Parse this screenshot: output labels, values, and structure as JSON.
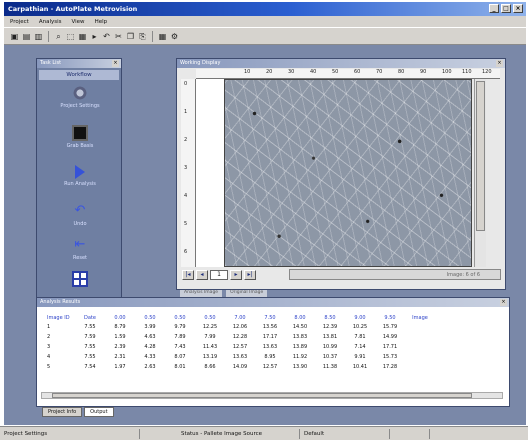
{
  "window": {
    "title": "Carpathian - AutoPlate Metrovision"
  },
  "menu": [
    "Project",
    "Analysis",
    "View",
    "Help"
  ],
  "toolbar": {
    "icons": [
      "new-icon",
      "open-icon",
      "save-icon",
      "zoom-icon",
      "select-icon",
      "print-icon",
      "arrow-icon",
      "undo-icon",
      "cut-icon",
      "copy-icon",
      "paste-icon",
      "grid-icon",
      "settings-icon"
    ]
  },
  "task_panel": {
    "title": "Task List",
    "header": "Workflow",
    "items": [
      {
        "label": "Project Settings",
        "icon": "gear-icon"
      },
      {
        "label": "Grab Basis",
        "icon": "film-icon"
      },
      {
        "label": "Run Analysis",
        "icon": "play-icon"
      },
      {
        "label": "Undo",
        "icon": "undo-icon"
      },
      {
        "label": "Reset",
        "icon": "reset-icon"
      },
      {
        "label": "",
        "icon": "grid-icon"
      }
    ]
  },
  "image_window": {
    "title": "Working Display",
    "ruler_top": [
      "10",
      "20",
      "30",
      "40",
      "50",
      "60",
      "70",
      "80",
      "90",
      "100",
      "110",
      "120"
    ],
    "ruler_left": [
      "0",
      "1",
      "2",
      "3",
      "4",
      "5",
      "6"
    ],
    "page": "1",
    "status": "Image: 6 of 6",
    "tabs": [
      "Analysis Image",
      "Original Image"
    ]
  },
  "results": {
    "title": "Analysis Results",
    "headers": [
      "Image ID",
      "Date",
      "0.00",
      "0.50",
      "0.50",
      "0.50",
      "7.00",
      "7.50",
      "8.00",
      "8.50",
      "9.00",
      "9.50",
      "Image"
    ],
    "rows": [
      [
        "1",
        "7.55",
        "8.79",
        "3.99",
        "9.79",
        "12.25",
        "12.06",
        "13.56",
        "14.50",
        "12.39",
        "10.25",
        "15.79",
        ""
      ],
      [
        "2",
        "7.59",
        "1.59",
        "4.63",
        "7.89",
        "7.99",
        "12.28",
        "17.17",
        "13.83",
        "13.81",
        "7.81",
        "14.99",
        ""
      ],
      [
        "3",
        "7.55",
        "2.39",
        "4.28",
        "7.43",
        "11.43",
        "12.57",
        "13.63",
        "13.89",
        "10.99",
        "7.14",
        "17.71",
        ""
      ],
      [
        "4",
        "7.55",
        "2.31",
        "4.33",
        "8.07",
        "13.19",
        "13.63",
        "8.95",
        "11.92",
        "10.37",
        "9.91",
        "15.73",
        ""
      ],
      [
        "5",
        "7.54",
        "1.97",
        "2.63",
        "8.01",
        "8.66",
        "14.09",
        "12.57",
        "13.90",
        "11.38",
        "10.41",
        "17.28",
        ""
      ]
    ],
    "tabs": [
      "Project Info",
      "Output"
    ]
  },
  "statusbar": {
    "left": "Project Settings",
    "middle": "Status - Pallete Image Source",
    "right": "Default"
  }
}
